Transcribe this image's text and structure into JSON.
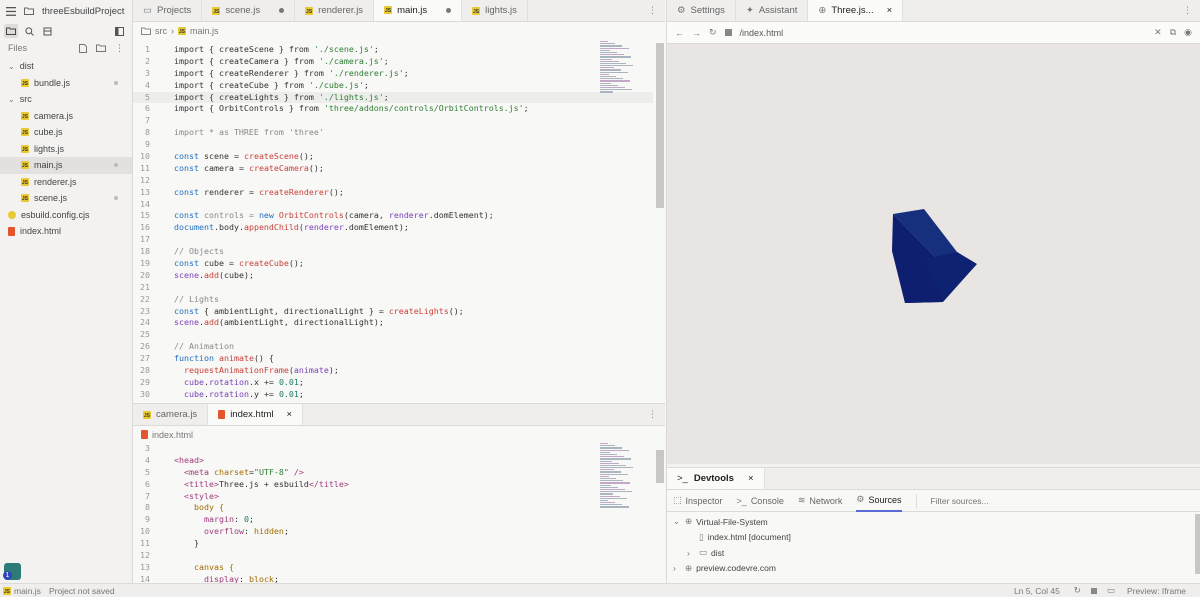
{
  "project": {
    "name": "threeEsbuildProject"
  },
  "files_label": "Files",
  "tree": [
    {
      "label": "dist",
      "type": "folder",
      "depth": 0
    },
    {
      "label": "bundle.js",
      "type": "js",
      "depth": 1,
      "dot": true
    },
    {
      "label": "src",
      "type": "folder",
      "depth": 0
    },
    {
      "label": "camera.js",
      "type": "js",
      "depth": 1
    },
    {
      "label": "cube.js",
      "type": "js",
      "depth": 1
    },
    {
      "label": "lights.js",
      "type": "js",
      "depth": 1
    },
    {
      "label": "main.js",
      "type": "js",
      "depth": 1,
      "dot": true,
      "selected": true
    },
    {
      "label": "renderer.js",
      "type": "js",
      "depth": 1
    },
    {
      "label": "scene.js",
      "type": "js",
      "depth": 1,
      "dot": true
    },
    {
      "label": "esbuild.config.cjs",
      "type": "cfg",
      "depth": 0
    },
    {
      "label": "index.html",
      "type": "html",
      "depth": 0
    }
  ],
  "editor_tabs": [
    {
      "label": "Projects",
      "icon": "folder-icon"
    },
    {
      "label": "scene.js",
      "icon": "js-file-icon",
      "dot": true
    },
    {
      "label": "renderer.js",
      "icon": "js-file-icon"
    },
    {
      "label": "main.js",
      "icon": "js-file-icon",
      "dot": true,
      "active": true
    },
    {
      "label": "lights.js",
      "icon": "js-file-icon"
    }
  ],
  "breadcrumb": {
    "folder": "src",
    "file": "main.js"
  },
  "main_code": [
    {
      "n": "1",
      "t": [
        [
          "import { createScene } from ",
          ""
        ],
        [
          "'./scene.js'",
          "st"
        ],
        [
          ";",
          ""
        ]
      ]
    },
    {
      "n": "2",
      "t": [
        [
          "import { createCamera } from ",
          ""
        ],
        [
          "'./camera.js'",
          "st"
        ],
        [
          ";",
          ""
        ]
      ]
    },
    {
      "n": "3",
      "t": [
        [
          "import { createRenderer } from ",
          ""
        ],
        [
          "'./renderer.js'",
          "st"
        ],
        [
          ";",
          ""
        ]
      ]
    },
    {
      "n": "4",
      "t": [
        [
          "import { createCube } from ",
          ""
        ],
        [
          "'./cube.js'",
          "st"
        ],
        [
          ";",
          ""
        ]
      ]
    },
    {
      "n": "5",
      "t": [
        [
          "import { createLights } from ",
          ""
        ],
        [
          "'./lights.js'",
          "st"
        ],
        [
          ";",
          ""
        ]
      ],
      "hl": true
    },
    {
      "n": "6",
      "t": [
        [
          "import { OrbitControls } from ",
          ""
        ],
        [
          "'three/addons/controls/OrbitControls.js'",
          "st"
        ],
        [
          ";",
          ""
        ]
      ]
    },
    {
      "n": "7",
      "t": []
    },
    {
      "n": "8",
      "t": [
        [
          "import * as THREE from 'three'",
          "cm"
        ]
      ]
    },
    {
      "n": "9",
      "t": []
    },
    {
      "n": "10",
      "t": [
        [
          "const ",
          "kw"
        ],
        [
          "scene = ",
          ""
        ],
        [
          "createScene",
          "fn"
        ],
        [
          "();",
          ""
        ]
      ]
    },
    {
      "n": "11",
      "t": [
        [
          "const ",
          "kw"
        ],
        [
          "camera = ",
          ""
        ],
        [
          "createCamera",
          "fn"
        ],
        [
          "();",
          ""
        ]
      ]
    },
    {
      "n": "12",
      "t": []
    },
    {
      "n": "13",
      "t": [
        [
          "const ",
          "kw"
        ],
        [
          "renderer = ",
          ""
        ],
        [
          "createRenderer",
          "fn"
        ],
        [
          "();",
          ""
        ]
      ]
    },
    {
      "n": "14",
      "t": []
    },
    {
      "n": "15",
      "t": [
        [
          "const ",
          "kw"
        ],
        [
          "controls = ",
          "cm"
        ],
        [
          "new ",
          "kw"
        ],
        [
          "OrbitControls",
          "fn"
        ],
        [
          "(camera, ",
          ""
        ],
        [
          "renderer",
          "pr"
        ],
        [
          ".domElement);",
          ""
        ]
      ]
    },
    {
      "n": "16",
      "t": [
        [
          "document",
          "kw"
        ],
        [
          ".body.",
          ""
        ],
        [
          "appendChild",
          "fn"
        ],
        [
          "(",
          ""
        ],
        [
          "renderer",
          "pr"
        ],
        [
          ".domElement);",
          ""
        ]
      ]
    },
    {
      "n": "17",
      "t": []
    },
    {
      "n": "18",
      "t": [
        [
          "// Objects",
          "cm"
        ]
      ]
    },
    {
      "n": "19",
      "t": [
        [
          "const ",
          "kw"
        ],
        [
          "cube = ",
          ""
        ],
        [
          "createCube",
          "fn"
        ],
        [
          "();",
          ""
        ]
      ]
    },
    {
      "n": "20",
      "t": [
        [
          "scene",
          "pr"
        ],
        [
          ".",
          ""
        ],
        [
          "add",
          "fn"
        ],
        [
          "(cube);",
          ""
        ]
      ]
    },
    {
      "n": "21",
      "t": []
    },
    {
      "n": "22",
      "t": [
        [
          "// Lights",
          "cm"
        ]
      ]
    },
    {
      "n": "23",
      "t": [
        [
          "const ",
          "kw"
        ],
        [
          "{ ambientLight, directionalLight } = ",
          ""
        ],
        [
          "createLights",
          "fn"
        ],
        [
          "();",
          ""
        ]
      ]
    },
    {
      "n": "24",
      "t": [
        [
          "scene",
          "pr"
        ],
        [
          ".",
          ""
        ],
        [
          "add",
          "fn"
        ],
        [
          "(ambientLight, directionalLight);",
          ""
        ]
      ]
    },
    {
      "n": "25",
      "t": []
    },
    {
      "n": "26",
      "t": [
        [
          "// Animation",
          "cm"
        ]
      ]
    },
    {
      "n": "27",
      "t": [
        [
          "function ",
          "kw"
        ],
        [
          "animate",
          "fn"
        ],
        [
          "() {",
          ""
        ]
      ]
    },
    {
      "n": "28",
      "t": [
        [
          "  ",
          ""
        ],
        [
          "requestAnimationFrame",
          "fn"
        ],
        [
          "(",
          ""
        ],
        [
          "animate",
          "pr"
        ],
        [
          ");",
          ""
        ]
      ]
    },
    {
      "n": "29",
      "t": [
        [
          "  ",
          ""
        ],
        [
          "cube",
          "pr"
        ],
        [
          ".",
          ""
        ],
        [
          "rotation",
          "pr"
        ],
        [
          ".x += ",
          ""
        ],
        [
          "0.01",
          "nu"
        ],
        [
          ";",
          ""
        ]
      ]
    },
    {
      "n": "30",
      "t": [
        [
          "  ",
          ""
        ],
        [
          "cube",
          "pr"
        ],
        [
          ".",
          ""
        ],
        [
          "rotation",
          "pr"
        ],
        [
          ".y += ",
          ""
        ],
        [
          "0.01",
          "nu"
        ],
        [
          ";",
          ""
        ]
      ]
    }
  ],
  "lower_tabs": [
    {
      "label": "camera.js",
      "icon": "js-file-icon"
    },
    {
      "label": "index.html",
      "icon": "html-file-icon",
      "active": true,
      "close": "×"
    }
  ],
  "lower_breadcrumb": "index.html",
  "html_code": [
    {
      "n": "3",
      "t": []
    },
    {
      "n": "4",
      "t": [
        [
          "<head>",
          "tg"
        ]
      ]
    },
    {
      "n": "5",
      "t": [
        [
          "  ",
          ""
        ],
        [
          "<meta ",
          "tg"
        ],
        [
          "charset",
          "at"
        ],
        [
          "=",
          ""
        ],
        [
          "\"UTF-8\"",
          "st"
        ],
        [
          " />",
          "tg"
        ]
      ]
    },
    {
      "n": "6",
      "t": [
        [
          "  ",
          ""
        ],
        [
          "<title>",
          "tg"
        ],
        [
          "Three.js + esbuild",
          ""
        ],
        [
          "</title>",
          "tg"
        ]
      ]
    },
    {
      "n": "7",
      "t": [
        [
          "  ",
          ""
        ],
        [
          "<style>",
          "tg"
        ]
      ]
    },
    {
      "n": "8",
      "t": [
        [
          "    body {",
          "at"
        ]
      ]
    },
    {
      "n": "9",
      "t": [
        [
          "      ",
          ""
        ],
        [
          "margin",
          "tg"
        ],
        [
          ": ",
          ""
        ],
        [
          "0",
          "nu"
        ],
        [
          ";",
          ""
        ]
      ]
    },
    {
      "n": "10",
      "t": [
        [
          "      ",
          ""
        ],
        [
          "overflow",
          "tg"
        ],
        [
          ": ",
          ""
        ],
        [
          "hidden",
          "at"
        ],
        [
          ";",
          ""
        ]
      ]
    },
    {
      "n": "11",
      "t": [
        [
          "    }",
          ""
        ]
      ]
    },
    {
      "n": "12",
      "t": []
    },
    {
      "n": "13",
      "t": [
        [
          "    canvas {",
          "at"
        ]
      ]
    },
    {
      "n": "14",
      "t": [
        [
          "      ",
          ""
        ],
        [
          "display",
          "tg"
        ],
        [
          ": ",
          ""
        ],
        [
          "block",
          "at"
        ],
        [
          ";",
          ""
        ]
      ]
    }
  ],
  "right_tabs": [
    {
      "label": "Settings",
      "icon": "gear-icon"
    },
    {
      "label": "Assistant",
      "icon": "sparkle-icon"
    },
    {
      "label": "Three.js...",
      "icon": "globe-icon",
      "active": true,
      "close": "×"
    }
  ],
  "preview": {
    "url": "/index.html",
    "cube_color": "#0d1f6e"
  },
  "devtools": {
    "title": "Devtools",
    "close": "×",
    "tabs": [
      {
        "label": "Inspector",
        "icon": "inspector-icon"
      },
      {
        "label": "Console",
        "icon": "console-icon"
      },
      {
        "label": "Network",
        "icon": "wifi-icon"
      },
      {
        "label": "Sources",
        "icon": "gear-icon",
        "active": true
      }
    ],
    "filter_placeholder": "Filter sources...",
    "sources": [
      {
        "label": "Virtual-File-System",
        "depth": 0,
        "icon": "globe-icon",
        "chevron": "v"
      },
      {
        "label": "index.html [document]",
        "depth": 1,
        "icon": "file-icon"
      },
      {
        "label": "dist",
        "depth": 1,
        "icon": "folder-icon",
        "chevron": ">"
      },
      {
        "label": "preview.codevre.com",
        "depth": 0,
        "icon": "globe-icon",
        "chevron": ">"
      }
    ]
  },
  "status": {
    "file": "main.js",
    "saved": "Project not saved",
    "cursor": "Ln 5, Col 45",
    "preview_mode": "Preview: Iframe"
  },
  "colors": {
    "accent": "#5b6bd6",
    "js": "#e9c931",
    "html": "#e4552b"
  }
}
